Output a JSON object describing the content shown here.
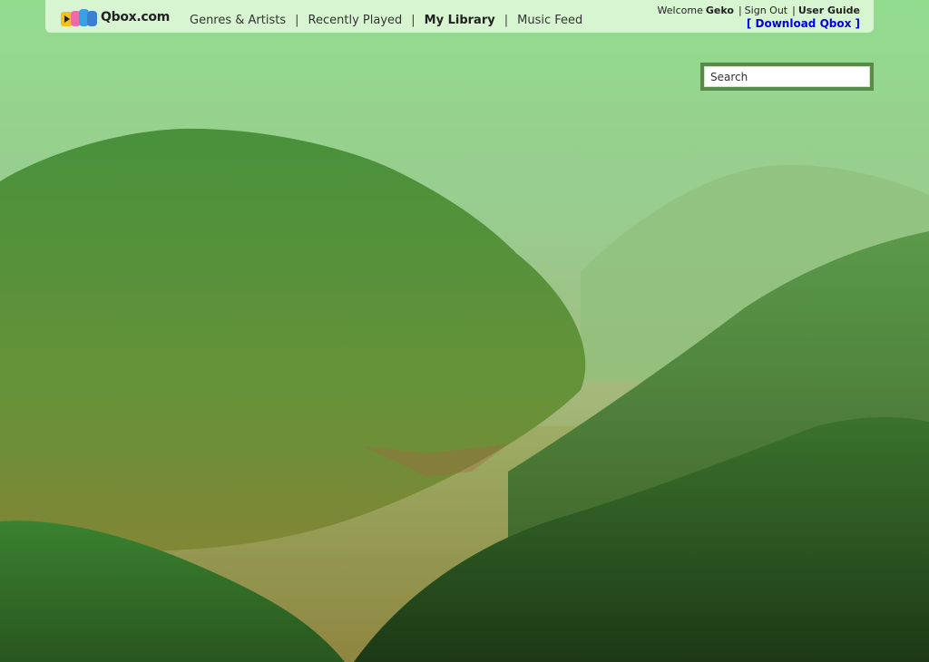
{
  "brand": {
    "name": "Qbox.com"
  },
  "nav": {
    "items": [
      {
        "label": "Genres & Artists"
      },
      {
        "label": "Recently Played"
      },
      {
        "label": "My Library"
      },
      {
        "label": "Music Feed"
      }
    ],
    "active_index": 2
  },
  "user": {
    "welcome": "Welcome",
    "name": "Geko",
    "sign_out": "Sign Out",
    "user_guide": "User Guide",
    "download": "[ Download Qbox ]"
  },
  "search": {
    "placeholder": "Search"
  },
  "colors": {
    "header_bg": "#d8f5d2",
    "link_blue": "#0000ee",
    "search_border": "#5a8a4a"
  }
}
